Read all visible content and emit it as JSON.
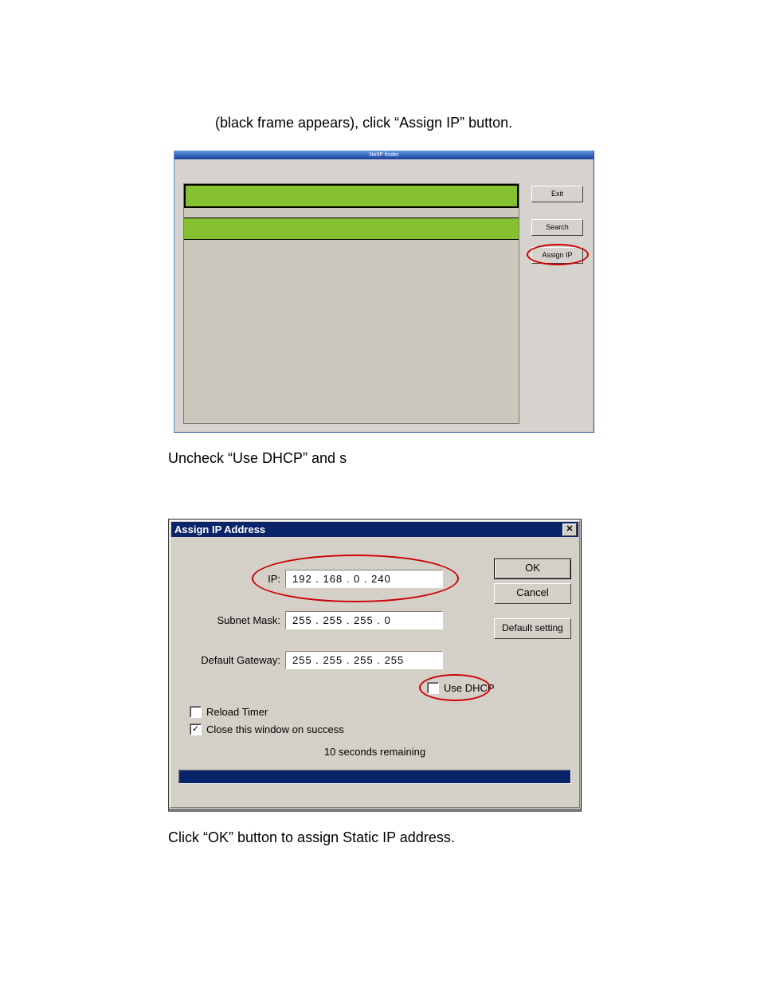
{
  "doc": {
    "line1": "(black frame appears), click “Assign IP” button.",
    "line2": "Uncheck “Use DHCP” and s",
    "line3": "Click “OK” button to assign Static IP address."
  },
  "win1": {
    "title": "NetIP finder",
    "buttons": {
      "exit": "Exit",
      "search": "Search",
      "assign": "Assign IP"
    }
  },
  "win2": {
    "title": "Assign IP Address",
    "close_glyph": "✕",
    "labels": {
      "ip": "IP:",
      "subnet": "Subnet Mask:",
      "gateway": "Default Gateway:"
    },
    "values": {
      "ip": "192 . 168 .  0  . 240",
      "subnet": "255 . 255 . 255 .  0",
      "gateway": "255 . 255 . 255 . 255"
    },
    "buttons": {
      "ok": "OK",
      "cancel": "Cancel",
      "default": "Default setting"
    },
    "checks": {
      "use_dhcp": "Use DHCP",
      "reload": "Reload Timer",
      "close_on_success": "Close this window on success"
    },
    "status": "10 seconds remaining",
    "checkmark": "✓"
  }
}
